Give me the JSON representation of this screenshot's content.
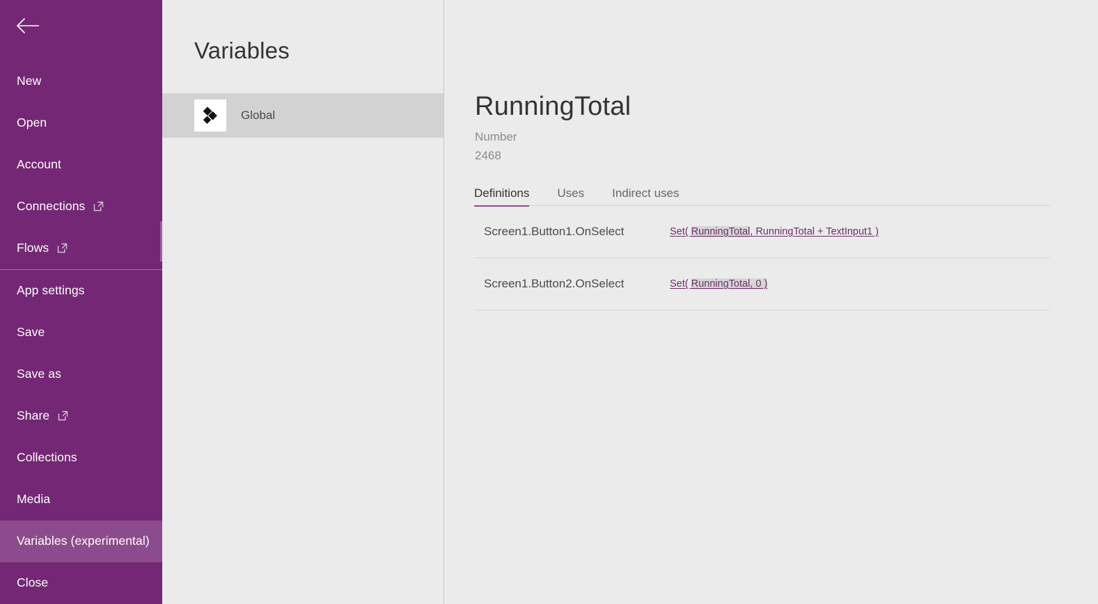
{
  "colors": {
    "sidebar_purple": "#742774",
    "sidebar_selected": "#8c4b8c",
    "accent": "#8c4b8c",
    "link_purple": "#6b2d6b",
    "panel_bg": "#ebebeb",
    "row_selected": "#d2d2d2",
    "highlight": "#d6d6d6"
  },
  "sidebar": {
    "back_icon": "back-arrow-icon",
    "items": [
      {
        "label": "New",
        "external": false,
        "selected": false
      },
      {
        "label": "Open",
        "external": false,
        "selected": false
      },
      {
        "label": "Account",
        "external": false,
        "selected": false
      },
      {
        "label": "Connections",
        "external": true,
        "selected": false
      },
      {
        "label": "Flows",
        "external": true,
        "selected": false
      },
      {
        "label": "App settings",
        "external": false,
        "selected": false
      },
      {
        "label": "Save",
        "external": false,
        "selected": false
      },
      {
        "label": "Save as",
        "external": false,
        "selected": false
      },
      {
        "label": "Share",
        "external": true,
        "selected": false
      },
      {
        "label": "Collections",
        "external": false,
        "selected": false
      },
      {
        "label": "Media",
        "external": false,
        "selected": false
      },
      {
        "label": "Variables (experimental)",
        "external": false,
        "selected": true
      },
      {
        "label": "Close",
        "external": false,
        "selected": false
      }
    ],
    "divider_after_index": 4
  },
  "list_panel": {
    "title": "Variables",
    "rows": [
      {
        "label": "Global",
        "icon": "global-variable-icon",
        "selected": true
      }
    ]
  },
  "detail": {
    "title": "RunningTotal",
    "type": "Number",
    "value": "2468",
    "tabs": [
      {
        "label": "Definitions",
        "active": true
      },
      {
        "label": "Uses",
        "active": false
      },
      {
        "label": "Indirect uses",
        "active": false
      }
    ],
    "definitions": [
      {
        "source": "Screen1.Button1.OnSelect",
        "formula_prefix": "Set( ",
        "formula_highlight": "RunningTotal",
        "formula_suffix": ", RunningTotal + TextInput1 )"
      },
      {
        "source": "Screen1.Button2.OnSelect",
        "formula_prefix": "Set( ",
        "formula_highlight": "RunningTotal, 0 )",
        "formula_suffix": ""
      }
    ]
  }
}
